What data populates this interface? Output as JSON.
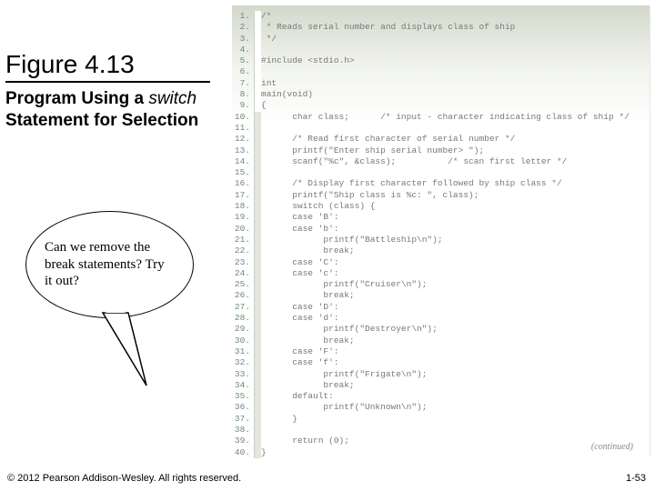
{
  "figure": {
    "title": "Figure 4.13",
    "subtitle_prefix": "Program Using a ",
    "subtitle_keyword": "switch",
    "subtitle_suffix": " Statement for Selection"
  },
  "callout": {
    "text": "Can we remove the break statements? Try it out?"
  },
  "code": {
    "continued_label": "(continued)",
    "lines": [
      {
        "n": "1",
        "t": "/*"
      },
      {
        "n": "2",
        "t": " * Reads serial number and displays class of ship"
      },
      {
        "n": "3",
        "t": " */"
      },
      {
        "n": "4",
        "t": ""
      },
      {
        "n": "5",
        "t": "#include <stdio.h>"
      },
      {
        "n": "6",
        "t": ""
      },
      {
        "n": "7",
        "t": "int"
      },
      {
        "n": "8",
        "t": "main(void)"
      },
      {
        "n": "9",
        "t": "{"
      },
      {
        "n": "10",
        "t": "      char class;      /* input - character indicating class of ship */"
      },
      {
        "n": "11",
        "t": ""
      },
      {
        "n": "12",
        "t": "      /* Read first character of serial number */"
      },
      {
        "n": "13",
        "t": "      printf(\"Enter ship serial number> \");"
      },
      {
        "n": "14",
        "t": "      scanf(\"%c\", &class);          /* scan first letter */"
      },
      {
        "n": "15",
        "t": ""
      },
      {
        "n": "16",
        "t": "      /* Display first character followed by ship class */"
      },
      {
        "n": "17",
        "t": "      printf(\"Ship class is %c: \", class);"
      },
      {
        "n": "18",
        "t": "      switch (class) {"
      },
      {
        "n": "19",
        "t": "      case 'B':"
      },
      {
        "n": "20",
        "t": "      case 'b':"
      },
      {
        "n": "21",
        "t": "            printf(\"Battleship\\n\");"
      },
      {
        "n": "22",
        "t": "            break;"
      },
      {
        "n": "23",
        "t": "      case 'C':"
      },
      {
        "n": "24",
        "t": "      case 'c':"
      },
      {
        "n": "25",
        "t": "            printf(\"Cruiser\\n\");"
      },
      {
        "n": "26",
        "t": "            break;"
      },
      {
        "n": "27",
        "t": "      case 'D':"
      },
      {
        "n": "28",
        "t": "      case 'd':"
      },
      {
        "n": "29",
        "t": "            printf(\"Destroyer\\n\");"
      },
      {
        "n": "30",
        "t": "            break;"
      },
      {
        "n": "31",
        "t": "      case 'F':"
      },
      {
        "n": "32",
        "t": "      case 'f':"
      },
      {
        "n": "33",
        "t": "            printf(\"Frigate\\n\");"
      },
      {
        "n": "34",
        "t": "            break;"
      },
      {
        "n": "35",
        "t": "      default:"
      },
      {
        "n": "36",
        "t": "            printf(\"Unknown\\n\");"
      },
      {
        "n": "37",
        "t": "      }"
      },
      {
        "n": "38",
        "t": ""
      },
      {
        "n": "39",
        "t": "      return (0);"
      },
      {
        "n": "40",
        "t": "}"
      }
    ]
  },
  "footer": {
    "copyright": "© 2012 Pearson Addison-Wesley. All rights reserved.",
    "page": "1-53"
  }
}
